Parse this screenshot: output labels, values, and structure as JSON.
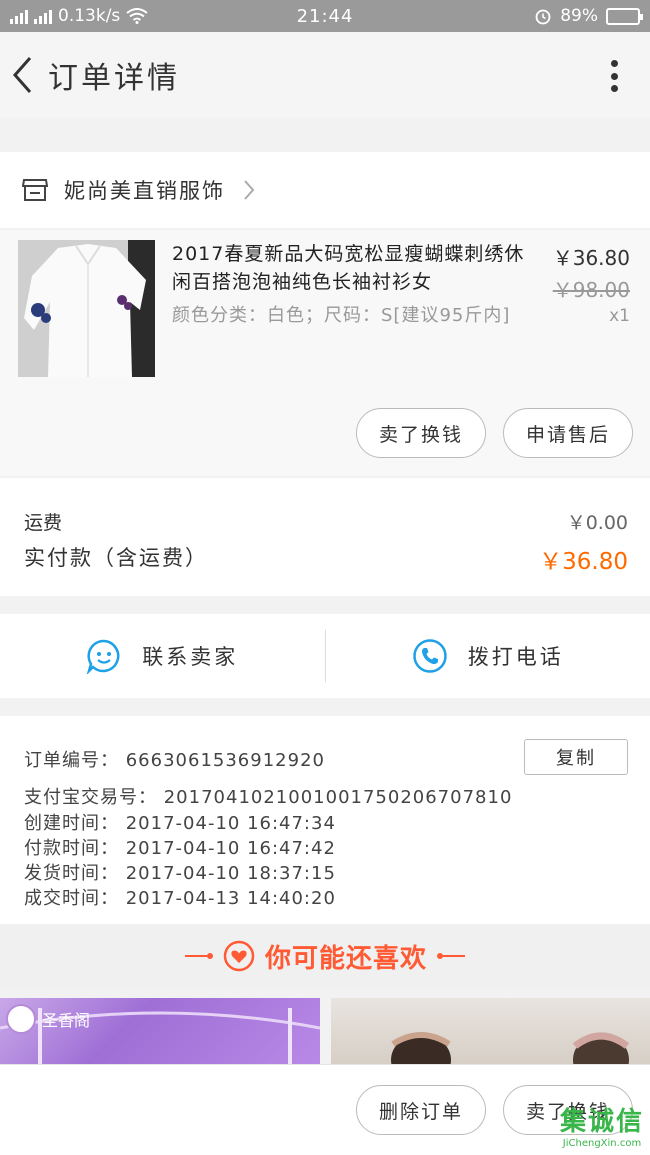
{
  "status_bar": {
    "network": "4G",
    "speed": "0.13k/s",
    "time": "21:44",
    "battery": "89%",
    "battery_level": 0.89
  },
  "nav": {
    "title": "订单详情"
  },
  "shop": {
    "name": "妮尚美直销服饰"
  },
  "product": {
    "title": "2017春夏新品大码宽松显瘦蝴蝶刺绣休闲百搭泡泡袖纯色长袖衬衫女",
    "spec": "颜色分类：白色；尺码：S[建议95斤内]",
    "price": "￥36.80",
    "original_price": "￥98.00",
    "quantity": "x1",
    "buttons": {
      "return": "卖了换钱",
      "after_sale": "申请售后"
    }
  },
  "fees": {
    "shipping_label": "运费",
    "shipping_value": "￥0.00",
    "total_label": "实付款（含运费）",
    "total_value": "￥36.80"
  },
  "contact": {
    "seller": "联系卖家",
    "call": "拨打电话"
  },
  "order_info": {
    "order_no_label": "订单编号：",
    "order_no": "6663061536912920",
    "copy": "复制",
    "alipay_label": "支付宝交易号：",
    "alipay_no": "2017041021001001750206707810",
    "created_label": "创建时间：",
    "created": "2017-04-10 16:47:34",
    "paid_label": "付款时间：",
    "paid": "2017-04-10 16:47:42",
    "shipped_label": "发货时间：",
    "shipped": "2017-04-10 18:37:15",
    "completed_label": "成交时间：",
    "completed": "2017-04-13 14:40:20"
  },
  "recommend": {
    "title": "你可能还喜欢",
    "item1_badge": "圣香阁"
  },
  "footer": {
    "delete": "删除订单",
    "sell": "卖了换钱"
  },
  "watermark": {
    "name": "集诚信",
    "url": "JiChengXin.com"
  },
  "colors": {
    "accent": "#ff6a00",
    "recommend": "#ff5a33",
    "icon_blue": "#1ea1e6"
  }
}
